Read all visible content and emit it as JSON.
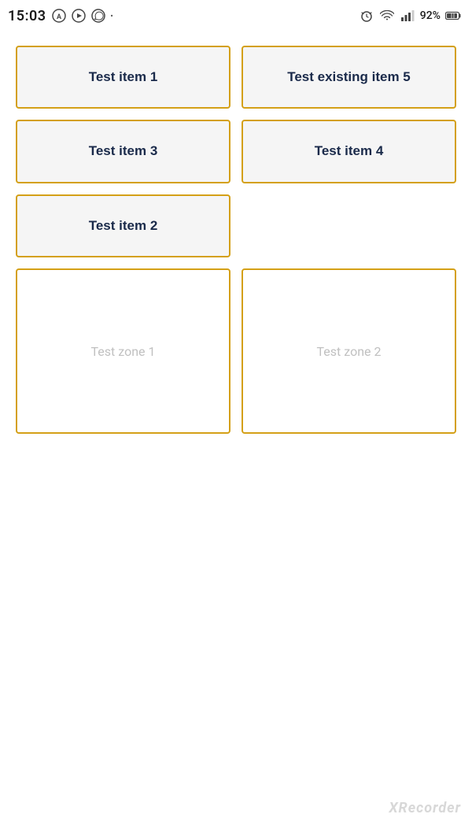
{
  "statusBar": {
    "time": "15:03",
    "battery": "92%",
    "icons": {
      "autopilot": "A",
      "screenRecorder": "▶",
      "whatsapp": "💬",
      "dot": "·",
      "alarm": "⏰",
      "wifi": "wifi",
      "signal": "signal",
      "battery": "battery"
    }
  },
  "items": [
    {
      "id": "item1",
      "label": "Test item 1"
    },
    {
      "id": "item5",
      "label": "Test existing item 5"
    },
    {
      "id": "item3",
      "label": "Test item 3"
    },
    {
      "id": "item4",
      "label": "Test item 4"
    },
    {
      "id": "item2",
      "label": "Test item 2"
    }
  ],
  "zones": [
    {
      "id": "zone1",
      "label": "Test zone 1"
    },
    {
      "id": "zone2",
      "label": "Test zone 2"
    }
  ],
  "watermark": "XRecorder",
  "colors": {
    "border": "#d4a017",
    "itemBg": "#f5f5f5",
    "itemText": "#1a2a4a",
    "zoneText": "#c0c0c0"
  }
}
